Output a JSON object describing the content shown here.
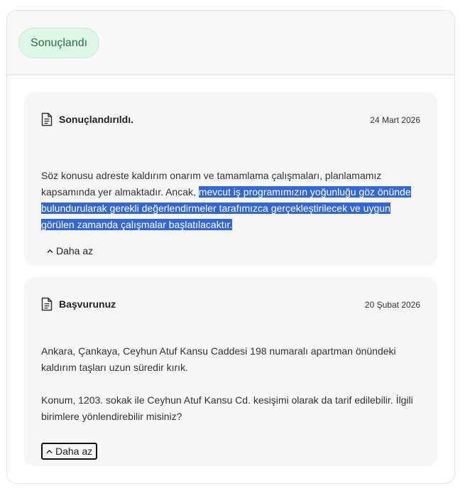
{
  "status": {
    "label": "Sonuçlandı",
    "color": "#23753f",
    "background": "#dff7e6"
  },
  "entries": [
    {
      "icon": "document-icon",
      "title": "Sonuçlandırıldı.",
      "date": "24 Mart 2026",
      "text_plain": "Söz konusu adreste kaldırım onarım ve tamamlama çalışmaları, planlamamız kapsamında yer almaktadır. Ancak, ",
      "text_selected": "mevcut iş programımızın yoğunluğu göz önünde bulundurularak gerekli değerlendirmeler tarafımızca gerçekleştirilecek ve uygun görülen zamanda çalışmalar başlatılacaktır.",
      "toggle_label": "Daha az"
    },
    {
      "icon": "document-icon",
      "title": "Başvurunuz",
      "date": "20 Şubat 2026",
      "paragraphs": [
        "Ankara, Çankaya, Ceyhun Atuf Kansu Caddesi 198 numaralı apartman önündeki kaldırım taşları uzun süredir kırık.",
        "Konum, 1203. sokak ile Ceyhun Atuf Kansu Cd. kesişimi olarak da tarif edilebilir. İlgili birimlere yönlendirebilir misiniz?"
      ],
      "toggle_label": "Daha az"
    }
  ],
  "colors": {
    "selection": "#3367d6",
    "card_background": "#f6f6f6"
  }
}
